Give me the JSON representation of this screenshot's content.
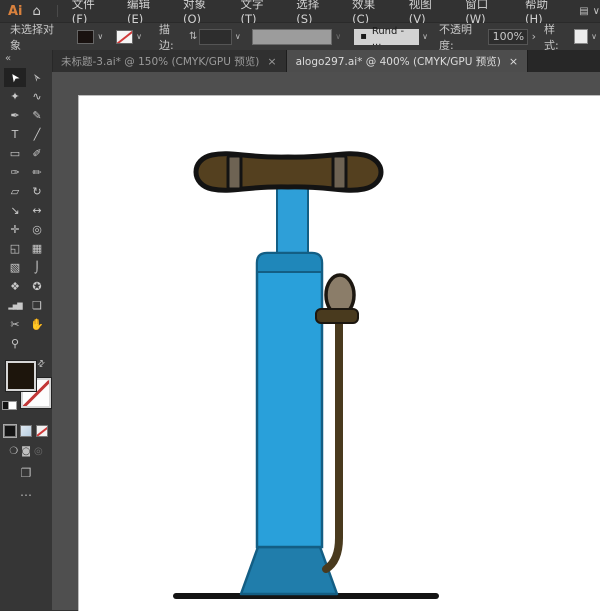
{
  "menu_bar": {
    "logo": "Ai",
    "home_glyph": "⌂",
    "items": [
      {
        "label": "文件(F)"
      },
      {
        "label": "编辑(E)"
      },
      {
        "label": "对象(O)"
      },
      {
        "label": "文字(T)"
      },
      {
        "label": "选择(S)"
      },
      {
        "label": "效果(C)"
      },
      {
        "label": "视图(V)"
      },
      {
        "label": "窗口(W)"
      },
      {
        "label": "帮助(H)"
      }
    ],
    "workspace_glyph": "▤",
    "chevron": "∨"
  },
  "control_bar": {
    "no_selection": "未选择对象",
    "fill_chevron": "∨",
    "stroke_chevron": "∨",
    "stroke_label": "描边:",
    "stepper_glyph": "⇅",
    "stroke_field_chevron": "∨",
    "brush_chevron": "∨",
    "width_profile": {
      "bullet": "▪",
      "value": "Rund - ...",
      "chevron": "∨"
    },
    "opacity_label": "不透明度:",
    "opacity_value": "100%",
    "expander": "›",
    "style_label": "样式:",
    "style_chevron": "∨"
  },
  "tab_bar": {
    "tabs": [
      {
        "title": "未标题-3.ai* @ 150% (CMYK/GPU 预览)",
        "close": "×",
        "active": false
      },
      {
        "title": "alogo297.ai* @ 400% (CMYK/GPU 预览)",
        "close": "×",
        "active": true
      }
    ]
  },
  "tools_panel": {
    "collapse_glyph": "«",
    "tools": [
      {
        "name": "selection",
        "glyph": "➤"
      },
      {
        "name": "direct-selection",
        "glyph": "➢"
      },
      {
        "name": "magic-wand",
        "glyph": "✦"
      },
      {
        "name": "lasso",
        "glyph": "∿"
      },
      {
        "name": "pen",
        "glyph": "✒"
      },
      {
        "name": "curvature",
        "glyph": "✎"
      },
      {
        "name": "type",
        "glyph": "T"
      },
      {
        "name": "line-segment",
        "glyph": "╱"
      },
      {
        "name": "rectangle",
        "glyph": "▭"
      },
      {
        "name": "paintbrush",
        "glyph": "✐"
      },
      {
        "name": "shaper",
        "glyph": "✑"
      },
      {
        "name": "pencil",
        "glyph": "✏"
      },
      {
        "name": "eraser",
        "glyph": "▱"
      },
      {
        "name": "rotate",
        "glyph": "↻"
      },
      {
        "name": "scale",
        "glyph": "↘"
      },
      {
        "name": "width",
        "glyph": "↔"
      },
      {
        "name": "puppet-warp",
        "glyph": "✛"
      },
      {
        "name": "free-transform",
        "glyph": "◎"
      },
      {
        "name": "shape-builder",
        "glyph": "◱"
      },
      {
        "name": "perspective-grid",
        "glyph": "▦"
      },
      {
        "name": "gradient",
        "glyph": "▧"
      },
      {
        "name": "eyedropper",
        "glyph": "⌡"
      },
      {
        "name": "blend",
        "glyph": "❖"
      },
      {
        "name": "symbol-sprayer",
        "glyph": "✪"
      },
      {
        "name": "column-graph",
        "glyph": "▂▅▇"
      },
      {
        "name": "artboard",
        "glyph": "❏"
      },
      {
        "name": "slice",
        "glyph": "✂"
      },
      {
        "name": "hand",
        "glyph": "✋"
      },
      {
        "name": "zoom",
        "glyph": "⚲"
      }
    ],
    "swap_glyph": "⇄",
    "fill_color": "#1d150c",
    "draw_modes": {
      "normal": "❍",
      "behind": "◙",
      "inside": "◎"
    },
    "screen_mode_glyph": "❐",
    "more_glyph": "⋯"
  },
  "canvas": {
    "pasteboard_color": "#4f4f4f",
    "artboard_color": "#ffffff"
  },
  "illustration": {
    "outline_dark": "#131313",
    "handle_fill": "#54401f",
    "stripe_fill": "#6e6353",
    "shaft_fill": "#2e9fd8",
    "body_fill": "#29a0da",
    "shoulder_fill": "#1f87ba",
    "base_fill": "#207dab",
    "blue_outline": "#135e84",
    "knob_fill": "#8b7d69",
    "knob_outline": "#1c1710",
    "hose_color": "#493a1e",
    "ground_color": "#141414"
  }
}
